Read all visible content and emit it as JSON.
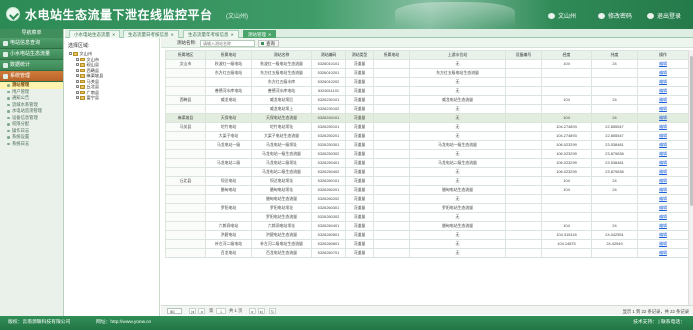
{
  "header": {
    "title": "水电站生态流量下泄在线监控平台",
    "subtitle": "(文山州)",
    "links": [
      "文山州",
      "修改密码",
      "退出登录"
    ]
  },
  "sidebar": {
    "heading": "导航菜单",
    "sections": [
      {
        "label": "电站信息查询"
      },
      {
        "label": "小水电站生态流量"
      },
      {
        "label": "数据统计"
      },
      {
        "label": "系统管理"
      }
    ],
    "items": [
      "测站管理",
      "用户管理",
      "通知公告",
      "流域水系管理",
      "水电站监测管理",
      "设备信息管理",
      "权限分配",
      "操作日志",
      "系统设置",
      "系统日志"
    ]
  },
  "tabs": [
    "小水电站生态流量",
    "生态流量日考核信息",
    "生态流量年考核信息",
    "测站管理"
  ],
  "tree": {
    "heading": "选择区域:",
    "nodes": [
      "文山州",
      "文山市",
      "砚山县",
      "西畴县",
      "麻栗坡县",
      "马关县",
      "丘北县",
      "广南县",
      "富宁县"
    ]
  },
  "search": {
    "label": "测站名称:",
    "placeholder": "请输入测站名称",
    "button": "查询"
  },
  "table": {
    "columns": [
      "所属地区",
      "所属电站",
      "测站名称",
      "测站编码",
      "测站类型",
      "所属电站",
      "上游水位站",
      "设备编号",
      "经度",
      "纬度",
      "操作"
    ],
    "rows": [
      [
        "文山市",
        "秋波红一级电站",
        "秋波红一级电站生态流量",
        "5326010101",
        "河道量",
        "",
        "无",
        "",
        "104",
        "24",
        "编辑"
      ],
      [
        "",
        "东方红五级电站",
        "东方红五级电站生态流量",
        "5326010201",
        "河道量",
        "",
        "东方红五级电站生态流量",
        "",
        "",
        "",
        "编辑"
      ],
      [
        "",
        "",
        "东方红五级水库",
        "5326010202",
        "河道量",
        "",
        "无",
        "",
        "",
        "",
        "编辑"
      ],
      [
        "",
        "善德河水库电站",
        "善德河水库电站",
        "5326011101",
        "河道量",
        "",
        "无",
        "",
        "",
        "",
        "编辑"
      ],
      [
        "西畴县",
        "威龙电站",
        "威龙电站坝后",
        "5326230101",
        "河道量",
        "",
        "威龙电站生态流量",
        "",
        "104",
        "24",
        "编辑"
      ],
      [
        "",
        "",
        "威龙电站坝上",
        "5326230102",
        "河道量",
        "",
        "无",
        "",
        "",
        "",
        "编辑"
      ],
      [
        "麻栗坡县",
        "天保电站",
        "天保电站生态流量",
        "5326240101",
        "河道量",
        "",
        "无",
        "",
        "104",
        "24",
        "编辑"
      ],
      [
        "马关县",
        "坨竹电站",
        "坨竹电站坝址",
        "5326250101",
        "河道量",
        "",
        "无",
        "",
        "104.274893",
        "22.855547",
        "编辑"
      ],
      [
        "",
        "大梁子电站",
        "大梁子电站生态流量",
        "5326250201",
        "河道量",
        "",
        "无",
        "",
        "104.274893",
        "22.855547",
        "编辑"
      ],
      [
        "",
        "马龙电站一级",
        "马龙电站一级坝址",
        "5326250301",
        "河道量",
        "",
        "马龙电站一级生态流量",
        "",
        "106.023299",
        "23.538481",
        "编辑"
      ],
      [
        "",
        "",
        "马龙电站一级生态流量",
        "5326250302",
        "河道量",
        "",
        "无",
        "",
        "106.023299",
        "23.879638",
        "编辑"
      ],
      [
        "",
        "马龙电站二级",
        "马龙电站二级坝址",
        "5326250401",
        "河道量",
        "",
        "马龙电站二级生态流量",
        "",
        "106.023299",
        "23.538481",
        "编辑"
      ],
      [
        "",
        "",
        "马龙电站二级生态流量",
        "5326250402",
        "河道量",
        "",
        "无",
        "",
        "106.023299",
        "23.879638",
        "编辑"
      ],
      [
        "丘北县",
        "坝达电站",
        "坝达电站坝址",
        "5326260101",
        "河道量",
        "",
        "无",
        "",
        "104",
        "24",
        "编辑"
      ],
      [
        "",
        "腊甸电站",
        "腊甸电站坝址",
        "5326260201",
        "河道量",
        "",
        "腊甸电站生态流量",
        "",
        "104",
        "24",
        "编辑"
      ],
      [
        "",
        "",
        "腊甸电站生态流量",
        "5326260202",
        "河道量",
        "",
        "无",
        "",
        "",
        "",
        "编辑"
      ],
      [
        "",
        "罗阳电站",
        "罗阳电站坝址",
        "5326260301",
        "河道量",
        "",
        "罗阳电站生态流量",
        "",
        "",
        "",
        "编辑"
      ],
      [
        "",
        "",
        "罗阳电站生态流量",
        "5326260302",
        "河道量",
        "",
        "无",
        "",
        "",
        "",
        "编辑"
      ],
      [
        "",
        "六郎洞电站",
        "六郎洞电站坝址",
        "5326260401",
        "河道量",
        "",
        "腊甸电站生态流量",
        "",
        "104",
        "24",
        "编辑"
      ],
      [
        "",
        "洪碧电站",
        "洪碧电站生态流量",
        "5326260501",
        "河道量",
        "",
        "无",
        "",
        "104.315118",
        "24.042551",
        "编辑"
      ],
      [
        "",
        "补左河二级电站",
        "补左河二级电站生态流量",
        "5326260601",
        "河道量",
        "",
        "无",
        "",
        "104.14875",
        "24.42549",
        "编辑"
      ],
      [
        "",
        "百龙电站",
        "百龙电站生态流量",
        "5326260701",
        "河道量",
        "",
        "无",
        "",
        "",
        "",
        "编辑"
      ]
    ]
  },
  "pager": {
    "size": "50",
    "page_label": "第",
    "page": "1",
    "total_label": "共 1 页",
    "info": "显示 1 到 22 条记录，共 22 条记录"
  },
  "footer": {
    "left": "版权：云南源联科技有限公司",
    "mid": "网址：http://www.yonw.cn",
    "right_a": "技术支持：",
    "right_b": "联系电话："
  }
}
